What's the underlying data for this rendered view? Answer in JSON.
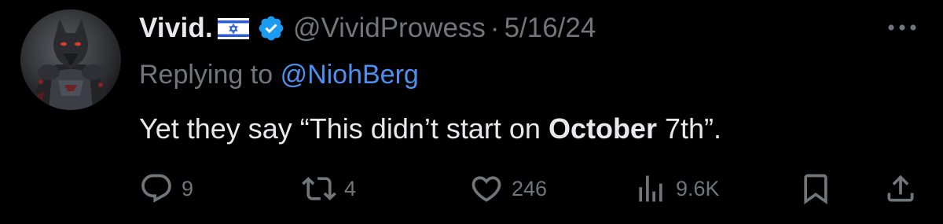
{
  "tweet": {
    "author": {
      "display_name": "Vivid.",
      "flag": "israel-flag-icon",
      "verified": "verified-badge-icon",
      "handle": "@VividProwess",
      "separator": "·",
      "date": "5/16/24",
      "avatar": "dark-wolf-warrior-avatar"
    },
    "reply": {
      "prefix": "Replying to",
      "handle": "@NiohBerg"
    },
    "text": {
      "before": "Yet they say “This didn’t start on ",
      "bold": "October",
      "after": " 7th”."
    },
    "actions": {
      "replies": "9",
      "reposts": "4",
      "likes": "246",
      "views": "9.6K"
    }
  },
  "colors": {
    "background": "#000000",
    "primary_text": "#e7e9ea",
    "secondary_text": "#71767b",
    "link": "#4f8ff0",
    "verified_badge": "#1d9bf0"
  }
}
